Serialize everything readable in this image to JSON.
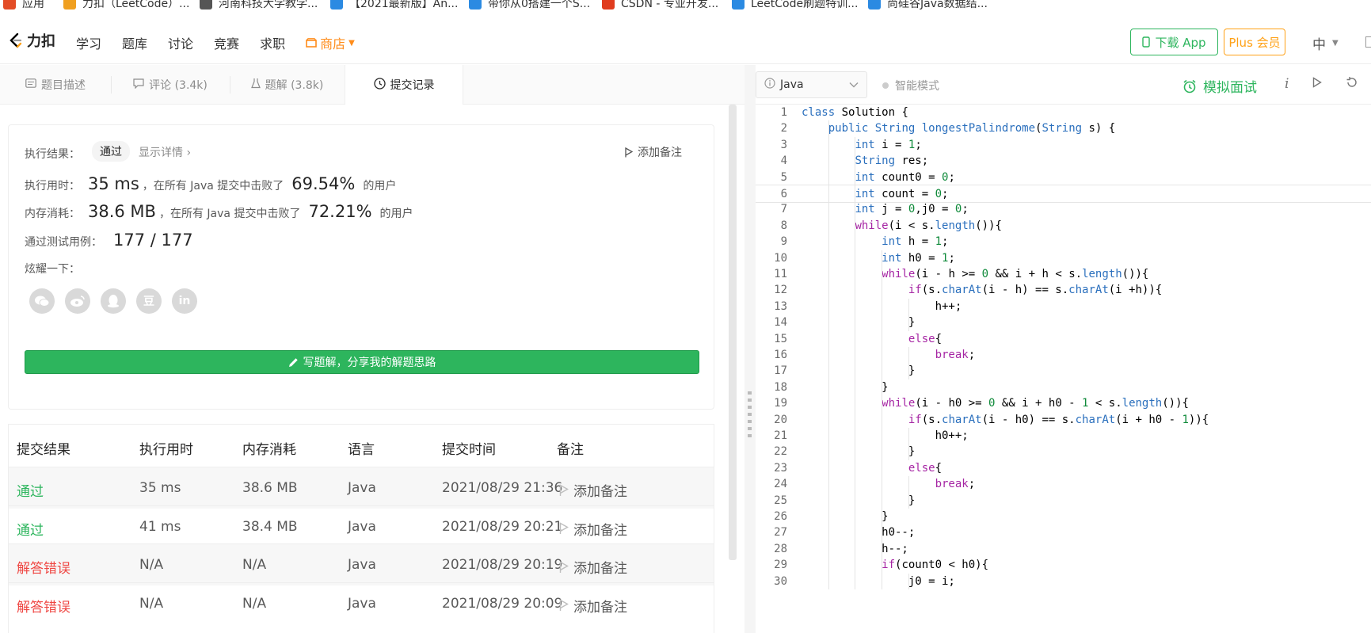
{
  "bookmarks": [
    {
      "label": "应用",
      "color": "#e34c26"
    },
    {
      "label": "力扣（LeetCode）...",
      "color": "#f0a020"
    },
    {
      "label": "河南科技大学教学...",
      "color": "#555555"
    },
    {
      "label": "【2021最新版】An...",
      "color": "#2b8ae2"
    },
    {
      "label": "带你从0搭建一个S...",
      "color": "#2b8ae2"
    },
    {
      "label": "CSDN - 专业开发...",
      "color": "#e03c1e"
    },
    {
      "label": "LeetCode刷题特训...",
      "color": "#2b8ae2"
    },
    {
      "label": "尚硅谷Java数据结...",
      "color": "#2b8ae2"
    }
  ],
  "nav": {
    "logo": "力扣",
    "links": [
      "学习",
      "题库",
      "讨论",
      "竞赛",
      "求职"
    ],
    "store": "商店",
    "download": "下载 App",
    "plus": "Plus 会员",
    "lang": "中"
  },
  "tabs": [
    {
      "label": "题目描述",
      "icon": "description-icon"
    },
    {
      "label": "评论 (3.4k)",
      "icon": "comment-icon"
    },
    {
      "label": "题解 (3.8k)",
      "icon": "flask-icon"
    },
    {
      "label": "提交记录",
      "icon": "clock-icon",
      "active": true
    }
  ],
  "result": {
    "status_label": "执行结果：",
    "status": "通过",
    "detail": "显示详情 ›",
    "add_note": "添加备注",
    "time_label": "执行用时：",
    "time": "35 ms",
    "time_text": "，在所有 Java 提交中击败了",
    "time_pct": "69.54%",
    "users": "的用户",
    "mem_label": "内存消耗：",
    "mem": "38.6 MB",
    "mem_text": "，在所有 Java 提交中击败了",
    "mem_pct": "72.21%",
    "tests_label": "通过测试用例：",
    "tests": "177 / 177",
    "share_label": "炫耀一下：",
    "share_icons": [
      "wechat-icon",
      "weibo-icon",
      "qq-icon",
      "douban-icon",
      "linkedin-icon"
    ],
    "write_btn": "写题解，分享我的解题思路"
  },
  "submissions": {
    "headers": [
      "提交结果",
      "执行用时",
      "内存消耗",
      "语言",
      "提交时间",
      "备注"
    ],
    "rows": [
      {
        "status": "通过",
        "ok": true,
        "time": "35 ms",
        "mem": "38.6 MB",
        "lang": "Java",
        "date": "2021/08/29 21:36",
        "note": "添加备注"
      },
      {
        "status": "通过",
        "ok": true,
        "time": "41 ms",
        "mem": "38.4 MB",
        "lang": "Java",
        "date": "2021/08/29 20:21",
        "note": "添加备注"
      },
      {
        "status": "解答错误",
        "ok": false,
        "time": "N/A",
        "mem": "N/A",
        "lang": "Java",
        "date": "2021/08/29 20:19",
        "note": "添加备注"
      },
      {
        "status": "解答错误",
        "ok": false,
        "time": "N/A",
        "mem": "N/A",
        "lang": "Java",
        "date": "2021/08/29 20:09",
        "note": "添加备注"
      }
    ]
  },
  "editor": {
    "language": "Java",
    "smart_mode": "智能模式",
    "mock": "模拟面试",
    "current_line": 6,
    "lines": [
      "class Solution {",
      "    public String longestPalindrome(String s) {",
      "        int i = 1;",
      "        String res;",
      "        int count0 = 0;",
      "        int count = 0;",
      "        int j = 0,j0 = 0;",
      "        while(i < s.length()){",
      "            int h = 1;",
      "            int h0 = 1;",
      "            while(i - h >= 0 && i + h < s.length()){",
      "                if(s.charAt(i - h) == s.charAt(i +h)){",
      "                    h++;",
      "                }",
      "                else{",
      "                    break;",
      "                }",
      "            }",
      "            while(i - h0 >= 0 && i + h0 - 1 < s.length()){",
      "                if(s.charAt(i - h0) == s.charAt(i + h0 - 1)){",
      "                    h0++;",
      "                }",
      "                else{",
      "                    break;",
      "                }",
      "            }",
      "            h0--;",
      "            h--;",
      "            if(count0 < h0){",
      "                j0 = i;"
    ]
  }
}
